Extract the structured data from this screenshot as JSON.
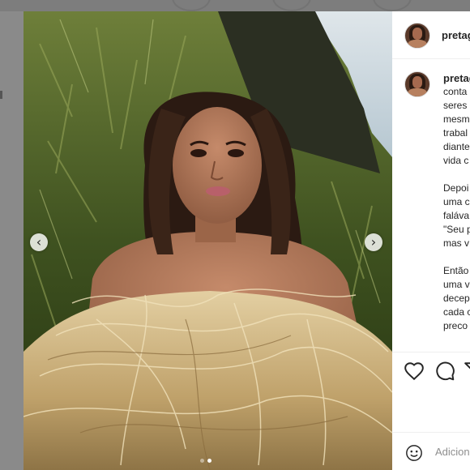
{
  "post": {
    "username": "pretag",
    "caption_lines": [
      [
        "conta",
        "seres",
        "mesm",
        "trabal",
        "diante",
        "vida c"
      ],
      [
        "Depoi",
        "uma c",
        "faláva",
        "\"Seu p",
        "mas v"
      ],
      [
        "Então",
        "uma v",
        "decep",
        "cada c",
        "preco"
      ]
    ]
  },
  "carousel": {
    "prev_label": "‹",
    "next_label": "›",
    "slide_count": 2,
    "active_index": 1
  },
  "actions": {
    "like_icon": "heart-icon",
    "comment_icon": "comment-icon",
    "share_icon": "share-icon"
  },
  "comment_box": {
    "placeholder": "Adicion"
  },
  "colors": {
    "panel_bg": "#ffffff",
    "text": "#262626",
    "muted": "#8e8e8e",
    "backdrop": "#8a8a8a"
  }
}
